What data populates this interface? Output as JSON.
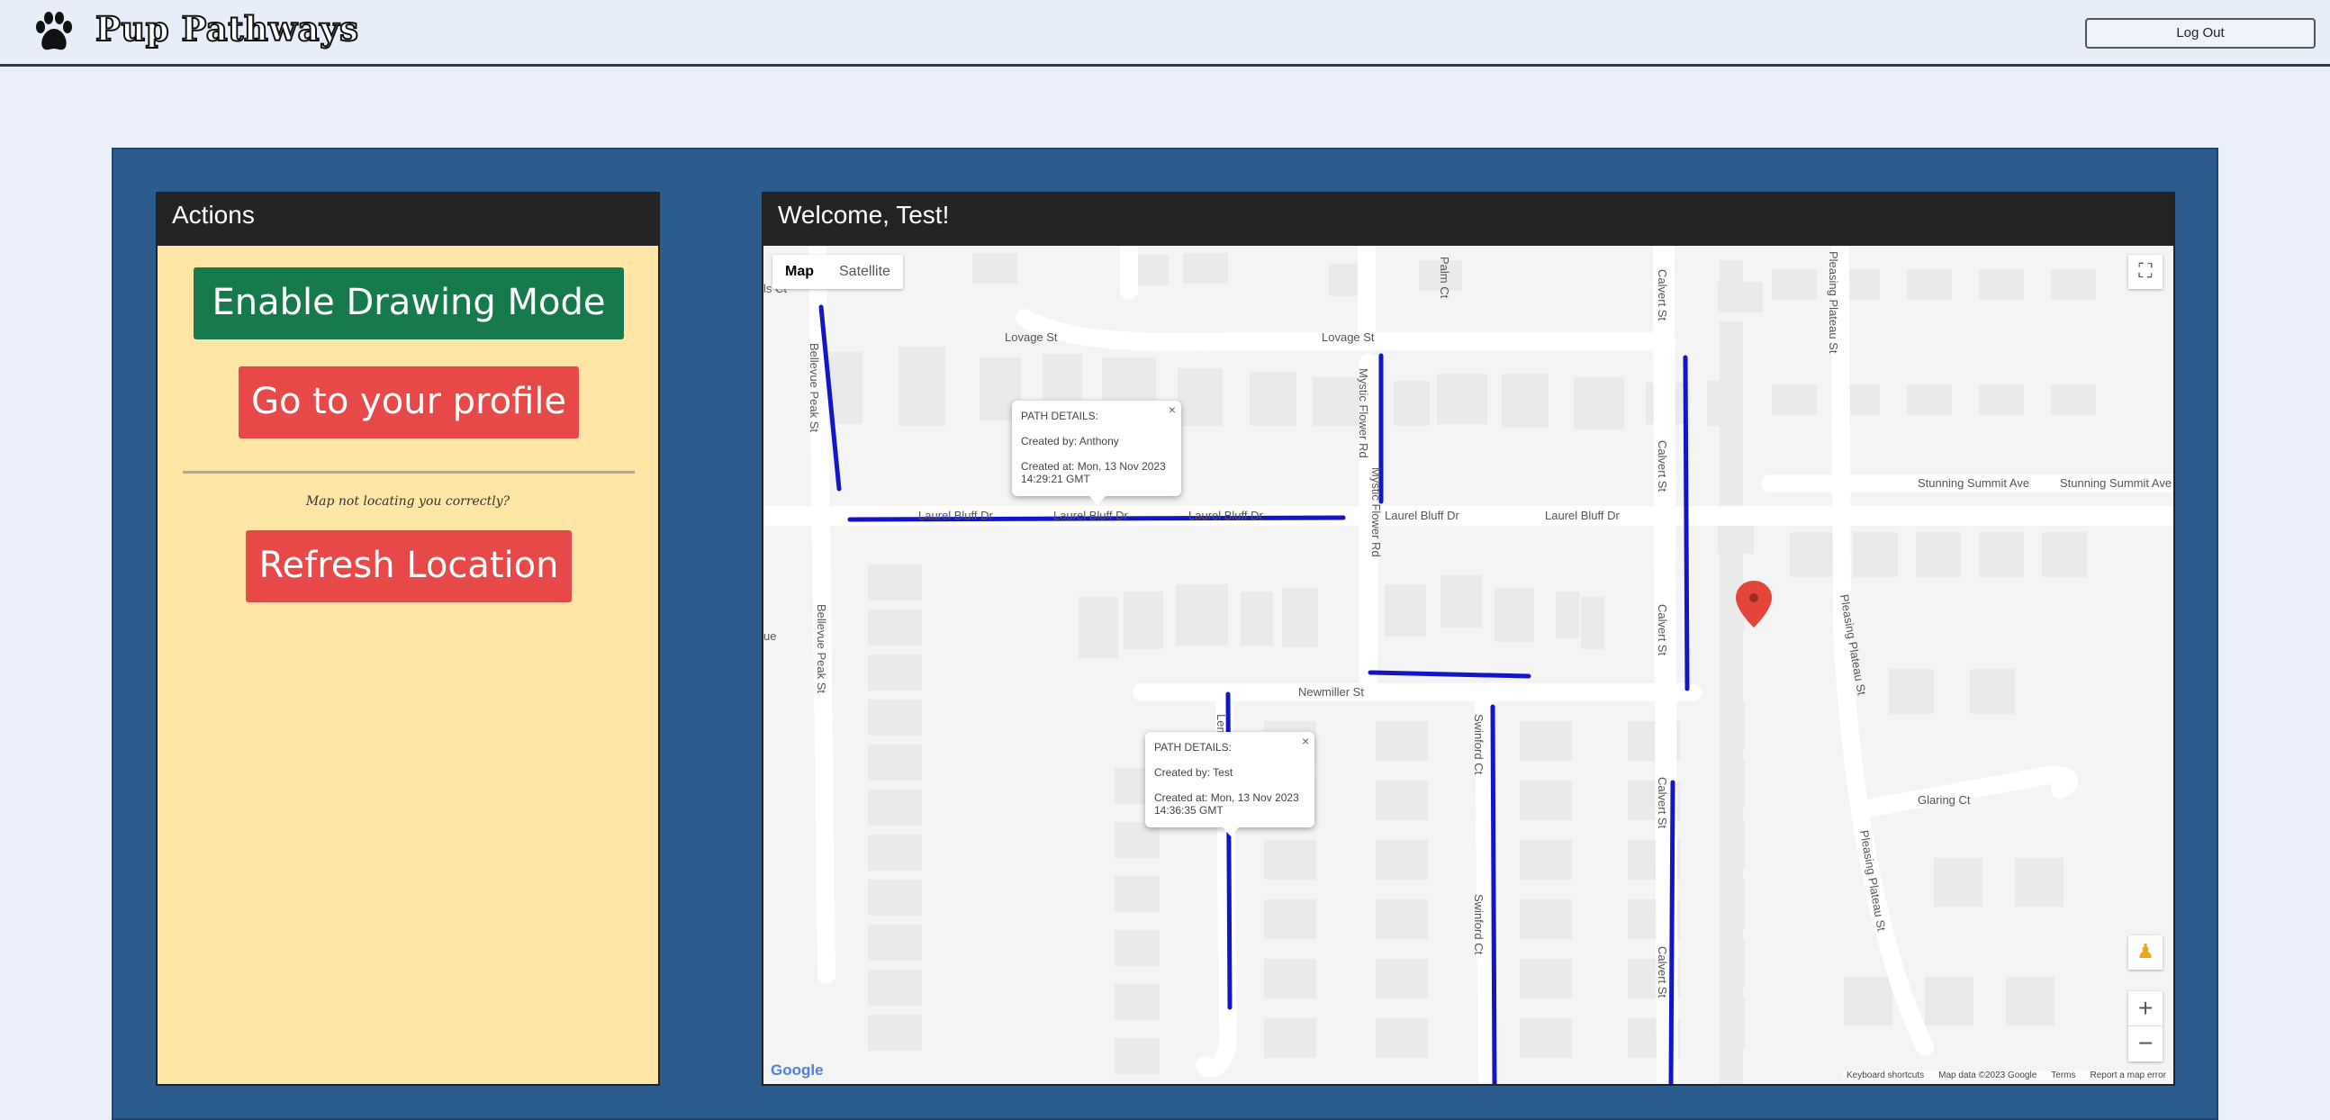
{
  "header": {
    "app_name": "Pup Pathways",
    "logout_label": "Log Out"
  },
  "actions": {
    "title": "Actions",
    "enable_drawing_label": "Enable Drawing Mode",
    "profile_label": "Go to your profile",
    "hint": "Map not locating you correctly?",
    "refresh_label": "Refresh Location"
  },
  "map_card": {
    "title": "Welcome, Test!",
    "map_type": {
      "map_label": "Map",
      "satellite_label": "Satellite",
      "selected": "Map"
    },
    "streets": {
      "lovage_1": "Lovage St",
      "lovage_2": "Lovage St",
      "laurel_1": "Laurel Bluff Dr",
      "laurel_2": "Laurel Bluff Dr",
      "laurel_3": "Laurel Bluff Dr",
      "laurel_4": "Laurel Bluff Dr",
      "laurel_5": "Laurel Bluff Dr",
      "newmiller": "Newmiller St",
      "stunning_1": "Stunning Summit Ave",
      "stunning_2": "Stunning Summit Ave",
      "glaring": "Glaring Ct",
      "bellevue_1": "Bellevue Peak St",
      "bellevue_2": "Bellevue Peak St",
      "mystic_1": "Mystic Flower Rd",
      "mystic_2": "Mystic Flower Rd",
      "palm": "Palm Ct",
      "calvert_1": "Calvert St",
      "calvert_2": "Calvert St",
      "calvert_3": "Calvert St",
      "calvert_4": "Calvert St",
      "calvert_5": "Calvert St",
      "pleasing_1": "Pleasing Plateau St",
      "pleasing_2": "Pleasing Plateau St",
      "pleasing_3": "Pleasing Plateau St",
      "swinford_1": "Swinford Ct",
      "swinford_2": "Swinford Ct",
      "lemongrass": "Lemongrass Ct",
      "partial_ct": "ls Ct",
      "partial_ue": "ue"
    },
    "popups": [
      {
        "title": "PATH DETAILS:",
        "created_by": "Created by: Anthony",
        "created_at": "Created at: Mon, 13 Nov 2023 14:29:21 GMT"
      },
      {
        "title": "PATH DETAILS:",
        "created_by": "Created by: Test",
        "created_at": "Created at: Mon, 13 Nov 2023 14:36:35 GMT"
      }
    ],
    "attribution": {
      "google": "Google",
      "shortcuts": "Keyboard shortcuts",
      "map_data": "Map data ©2023 Google",
      "terms": "Terms",
      "report": "Report a map error"
    },
    "controls": {
      "zoom_in": "+",
      "zoom_out": "−"
    }
  },
  "colors": {
    "path": "#1515c8",
    "header_bg": "#e8eef9",
    "panel_bg": "#2b5c8d",
    "actions_bg": "#ffe6a6",
    "green_button": "#177a4d",
    "red_button": "#e74848",
    "marker": "#e4453a"
  }
}
